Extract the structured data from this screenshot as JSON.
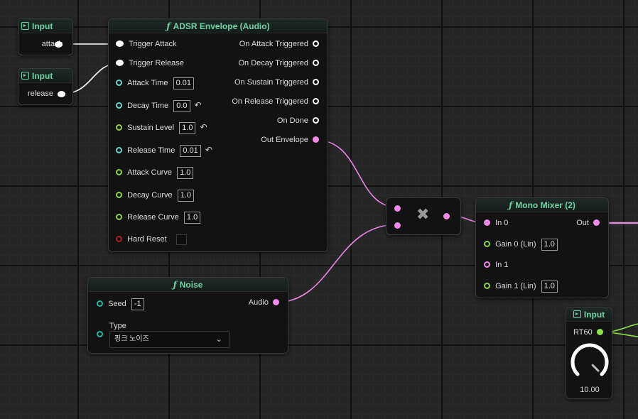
{
  "nodes": {
    "input_attack": {
      "title": "Input",
      "output": "attack"
    },
    "input_release": {
      "title": "Input",
      "output": "release"
    },
    "adsr": {
      "title": "ADSR Envelope (Audio)",
      "inputs": {
        "trigger_attack": "Trigger Attack",
        "trigger_release": "Trigger Release",
        "attack_time": "Attack Time",
        "decay_time": "Decay Time",
        "sustain_level": "Sustain Level",
        "release_time": "Release Time",
        "attack_curve": "Attack Curve",
        "decay_curve": "Decay Curve",
        "release_curve": "Release Curve",
        "hard_reset": "Hard Reset"
      },
      "values": {
        "attack_time": "0.01",
        "decay_time": "0.0",
        "sustain_level": "1.0",
        "release_time": "0.01",
        "attack_curve": "1.0",
        "decay_curve": "1.0",
        "release_curve": "1.0"
      },
      "outputs": {
        "on_attack_triggered": "On Attack Triggered",
        "on_decay_triggered": "On Decay Triggered",
        "on_sustain_triggered": "On Sustain Triggered",
        "on_release_triggered": "On Release Triggered",
        "on_done": "On Done",
        "out_envelope": "Out Envelope"
      }
    },
    "noise": {
      "title": "Noise",
      "seed_label": "Seed",
      "seed_value": "-1",
      "type_label": "Type",
      "type_value": "핑크 노이즈",
      "output": "Audio"
    },
    "multiply": {
      "glyph": "✖"
    },
    "mixer": {
      "title": "Mono Mixer (2)",
      "in0": "In 0",
      "gain0": "Gain 0 (Lin)",
      "gain0_value": "1.0",
      "in1": "In 1",
      "gain1": "Gain 1 (Lin)",
      "gain1_value": "1.0",
      "output": "Out"
    },
    "input_rt60": {
      "title": "Input",
      "output": "RT60",
      "knob_value": "10.00",
      "knob_level": 1.0
    }
  },
  "icons": {
    "function": "ƒ",
    "reset": "↶",
    "chevron": "⌄"
  },
  "colors": {
    "exec": "#ffffff",
    "float": "#6fd6c8",
    "float_green": "#8fd14f",
    "audio": "#f08ae6",
    "bool_red": "#b41e1e",
    "trigger_teal": "#1fb8a0",
    "rt60_green": "#8fe34a",
    "header_text": "#6fd3a6"
  }
}
